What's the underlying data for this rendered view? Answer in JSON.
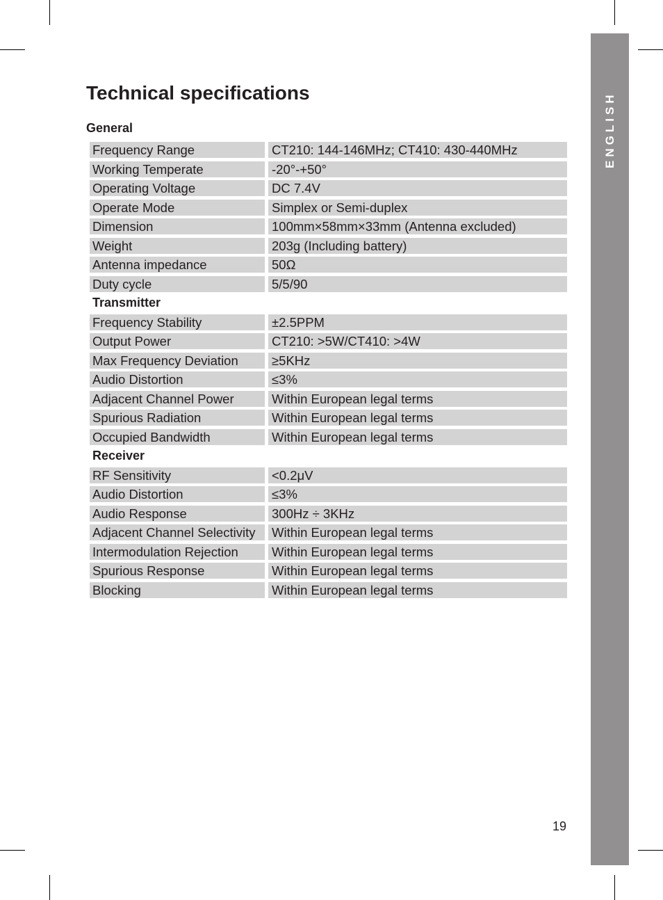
{
  "page": {
    "title": "Technical specifications",
    "language_tab": "ENGLISH",
    "page_number": "19"
  },
  "sections": [
    {
      "heading": "General",
      "rows": [
        {
          "label": "Frequency Range",
          "value": "CT210: 144-146MHz; CT410: 430-440MHz"
        },
        {
          "label": "Working Temperate",
          "value": "-20°-+50°"
        },
        {
          "label": "Operating Voltage",
          "value": "DC 7.4V"
        },
        {
          "label": "Operate Mode",
          "value": "Simplex or Semi-duplex"
        },
        {
          "label": "Dimension",
          "value": "100mm×58mm×33mm (Antenna excluded)"
        },
        {
          "label": "Weight",
          "value": "203g (Including battery)"
        },
        {
          "label": "Antenna impedance",
          "value": "50Ω"
        },
        {
          "label": "Duty cycle",
          "value": "5/5/90"
        }
      ]
    },
    {
      "heading": "Transmitter",
      "rows": [
        {
          "label": "Frequency Stability",
          "value": "±2.5PPM"
        },
        {
          "label": "Output Power",
          "value": "CT210: >5W/CT410: >4W"
        },
        {
          "label": "Max Frequency Deviation",
          "value": "≥5KHz"
        },
        {
          "label": "Audio Distortion",
          "value": "≤3%"
        },
        {
          "label": "Adjacent Channel Power",
          "value": "Within European legal terms"
        },
        {
          "label": "Spurious Radiation",
          "value": "Within European legal terms"
        },
        {
          "label": "Occupied Bandwidth",
          "value": "Within European legal terms"
        }
      ]
    },
    {
      "heading": "Receiver",
      "rows": [
        {
          "label": "RF Sensitivity",
          "value": "<0.2μV"
        },
        {
          "label": "Audio Distortion",
          "value": "≤3%"
        },
        {
          "label": "Audio Response",
          "value": "300Hz ÷ 3KHz"
        },
        {
          "label": "Adjacent Channel Selectivity",
          "value": "Within European legal terms"
        },
        {
          "label": "Intermodulation Rejection",
          "value": "Within European legal terms"
        },
        {
          "label": "Spurious Response",
          "value": "Within European legal terms"
        },
        {
          "label": "Blocking",
          "value": "Within European legal terms"
        }
      ]
    }
  ]
}
